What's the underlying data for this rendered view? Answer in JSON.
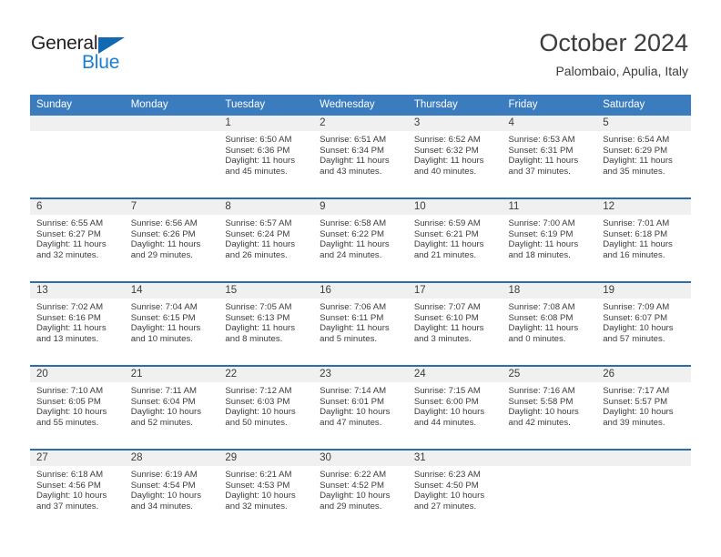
{
  "brand": {
    "name_top": "General",
    "name_bottom": "Blue",
    "color_dark": "#231f20",
    "color_blue": "#1a7fd4",
    "triangle_color": "#1168b3"
  },
  "header": {
    "title": "October 2024",
    "subtitle": "Palombaio, Apulia, Italy"
  },
  "theme": {
    "header_row_bg": "#3a7cbe",
    "row_divider": "#2f6cab",
    "daynum_band_bg": "#f0f0f0",
    "text": "#3c3c3c"
  },
  "calendar": {
    "weekday_headers": [
      "Sunday",
      "Monday",
      "Tuesday",
      "Wednesday",
      "Thursday",
      "Friday",
      "Saturday"
    ],
    "weeks": [
      [
        {
          "day": "",
          "sunrise": "",
          "sunset": "",
          "daylight_line1": "",
          "daylight_line2": ""
        },
        {
          "day": "",
          "sunrise": "",
          "sunset": "",
          "daylight_line1": "",
          "daylight_line2": ""
        },
        {
          "day": "1",
          "sunrise": "Sunrise: 6:50 AM",
          "sunset": "Sunset: 6:36 PM",
          "daylight_line1": "Daylight: 11 hours",
          "daylight_line2": "and 45 minutes."
        },
        {
          "day": "2",
          "sunrise": "Sunrise: 6:51 AM",
          "sunset": "Sunset: 6:34 PM",
          "daylight_line1": "Daylight: 11 hours",
          "daylight_line2": "and 43 minutes."
        },
        {
          "day": "3",
          "sunrise": "Sunrise: 6:52 AM",
          "sunset": "Sunset: 6:32 PM",
          "daylight_line1": "Daylight: 11 hours",
          "daylight_line2": "and 40 minutes."
        },
        {
          "day": "4",
          "sunrise": "Sunrise: 6:53 AM",
          "sunset": "Sunset: 6:31 PM",
          "daylight_line1": "Daylight: 11 hours",
          "daylight_line2": "and 37 minutes."
        },
        {
          "day": "5",
          "sunrise": "Sunrise: 6:54 AM",
          "sunset": "Sunset: 6:29 PM",
          "daylight_line1": "Daylight: 11 hours",
          "daylight_line2": "and 35 minutes."
        }
      ],
      [
        {
          "day": "6",
          "sunrise": "Sunrise: 6:55 AM",
          "sunset": "Sunset: 6:27 PM",
          "daylight_line1": "Daylight: 11 hours",
          "daylight_line2": "and 32 minutes."
        },
        {
          "day": "7",
          "sunrise": "Sunrise: 6:56 AM",
          "sunset": "Sunset: 6:26 PM",
          "daylight_line1": "Daylight: 11 hours",
          "daylight_line2": "and 29 minutes."
        },
        {
          "day": "8",
          "sunrise": "Sunrise: 6:57 AM",
          "sunset": "Sunset: 6:24 PM",
          "daylight_line1": "Daylight: 11 hours",
          "daylight_line2": "and 26 minutes."
        },
        {
          "day": "9",
          "sunrise": "Sunrise: 6:58 AM",
          "sunset": "Sunset: 6:22 PM",
          "daylight_line1": "Daylight: 11 hours",
          "daylight_line2": "and 24 minutes."
        },
        {
          "day": "10",
          "sunrise": "Sunrise: 6:59 AM",
          "sunset": "Sunset: 6:21 PM",
          "daylight_line1": "Daylight: 11 hours",
          "daylight_line2": "and 21 minutes."
        },
        {
          "day": "11",
          "sunrise": "Sunrise: 7:00 AM",
          "sunset": "Sunset: 6:19 PM",
          "daylight_line1": "Daylight: 11 hours",
          "daylight_line2": "and 18 minutes."
        },
        {
          "day": "12",
          "sunrise": "Sunrise: 7:01 AM",
          "sunset": "Sunset: 6:18 PM",
          "daylight_line1": "Daylight: 11 hours",
          "daylight_line2": "and 16 minutes."
        }
      ],
      [
        {
          "day": "13",
          "sunrise": "Sunrise: 7:02 AM",
          "sunset": "Sunset: 6:16 PM",
          "daylight_line1": "Daylight: 11 hours",
          "daylight_line2": "and 13 minutes."
        },
        {
          "day": "14",
          "sunrise": "Sunrise: 7:04 AM",
          "sunset": "Sunset: 6:15 PM",
          "daylight_line1": "Daylight: 11 hours",
          "daylight_line2": "and 10 minutes."
        },
        {
          "day": "15",
          "sunrise": "Sunrise: 7:05 AM",
          "sunset": "Sunset: 6:13 PM",
          "daylight_line1": "Daylight: 11 hours",
          "daylight_line2": "and 8 minutes."
        },
        {
          "day": "16",
          "sunrise": "Sunrise: 7:06 AM",
          "sunset": "Sunset: 6:11 PM",
          "daylight_line1": "Daylight: 11 hours",
          "daylight_line2": "and 5 minutes."
        },
        {
          "day": "17",
          "sunrise": "Sunrise: 7:07 AM",
          "sunset": "Sunset: 6:10 PM",
          "daylight_line1": "Daylight: 11 hours",
          "daylight_line2": "and 3 minutes."
        },
        {
          "day": "18",
          "sunrise": "Sunrise: 7:08 AM",
          "sunset": "Sunset: 6:08 PM",
          "daylight_line1": "Daylight: 11 hours",
          "daylight_line2": "and 0 minutes."
        },
        {
          "day": "19",
          "sunrise": "Sunrise: 7:09 AM",
          "sunset": "Sunset: 6:07 PM",
          "daylight_line1": "Daylight: 10 hours",
          "daylight_line2": "and 57 minutes."
        }
      ],
      [
        {
          "day": "20",
          "sunrise": "Sunrise: 7:10 AM",
          "sunset": "Sunset: 6:05 PM",
          "daylight_line1": "Daylight: 10 hours",
          "daylight_line2": "and 55 minutes."
        },
        {
          "day": "21",
          "sunrise": "Sunrise: 7:11 AM",
          "sunset": "Sunset: 6:04 PM",
          "daylight_line1": "Daylight: 10 hours",
          "daylight_line2": "and 52 minutes."
        },
        {
          "day": "22",
          "sunrise": "Sunrise: 7:12 AM",
          "sunset": "Sunset: 6:03 PM",
          "daylight_line1": "Daylight: 10 hours",
          "daylight_line2": "and 50 minutes."
        },
        {
          "day": "23",
          "sunrise": "Sunrise: 7:14 AM",
          "sunset": "Sunset: 6:01 PM",
          "daylight_line1": "Daylight: 10 hours",
          "daylight_line2": "and 47 minutes."
        },
        {
          "day": "24",
          "sunrise": "Sunrise: 7:15 AM",
          "sunset": "Sunset: 6:00 PM",
          "daylight_line1": "Daylight: 10 hours",
          "daylight_line2": "and 44 minutes."
        },
        {
          "day": "25",
          "sunrise": "Sunrise: 7:16 AM",
          "sunset": "Sunset: 5:58 PM",
          "daylight_line1": "Daylight: 10 hours",
          "daylight_line2": "and 42 minutes."
        },
        {
          "day": "26",
          "sunrise": "Sunrise: 7:17 AM",
          "sunset": "Sunset: 5:57 PM",
          "daylight_line1": "Daylight: 10 hours",
          "daylight_line2": "and 39 minutes."
        }
      ],
      [
        {
          "day": "27",
          "sunrise": "Sunrise: 6:18 AM",
          "sunset": "Sunset: 4:56 PM",
          "daylight_line1": "Daylight: 10 hours",
          "daylight_line2": "and 37 minutes."
        },
        {
          "day": "28",
          "sunrise": "Sunrise: 6:19 AM",
          "sunset": "Sunset: 4:54 PM",
          "daylight_line1": "Daylight: 10 hours",
          "daylight_line2": "and 34 minutes."
        },
        {
          "day": "29",
          "sunrise": "Sunrise: 6:21 AM",
          "sunset": "Sunset: 4:53 PM",
          "daylight_line1": "Daylight: 10 hours",
          "daylight_line2": "and 32 minutes."
        },
        {
          "day": "30",
          "sunrise": "Sunrise: 6:22 AM",
          "sunset": "Sunset: 4:52 PM",
          "daylight_line1": "Daylight: 10 hours",
          "daylight_line2": "and 29 minutes."
        },
        {
          "day": "31",
          "sunrise": "Sunrise: 6:23 AM",
          "sunset": "Sunset: 4:50 PM",
          "daylight_line1": "Daylight: 10 hours",
          "daylight_line2": "and 27 minutes."
        },
        {
          "day": "",
          "sunrise": "",
          "sunset": "",
          "daylight_line1": "",
          "daylight_line2": ""
        },
        {
          "day": "",
          "sunrise": "",
          "sunset": "",
          "daylight_line1": "",
          "daylight_line2": ""
        }
      ]
    ]
  }
}
